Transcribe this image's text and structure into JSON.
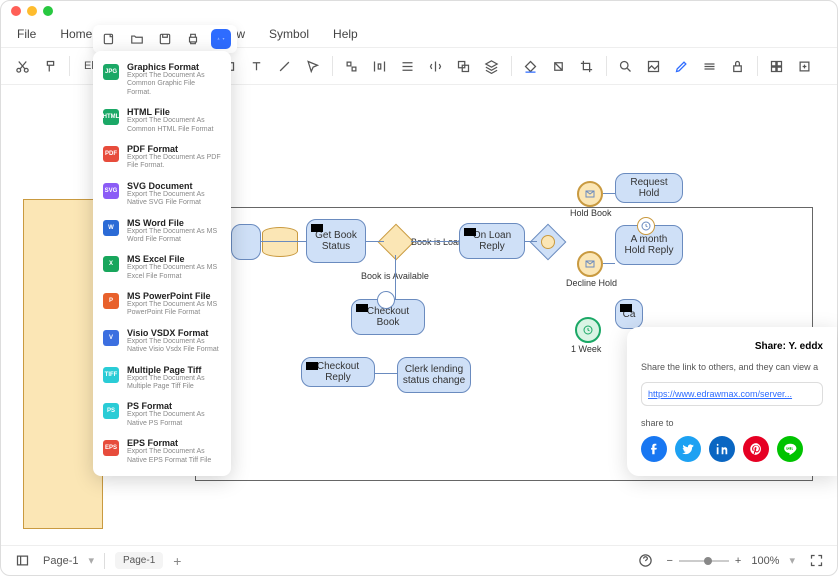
{
  "menubar": {
    "file": "File",
    "home": "Home",
    "view": "w",
    "symbol": "Symbol",
    "help": "Help"
  },
  "toolbar": {
    "element_label": "Ele"
  },
  "export_menu": {
    "items": [
      {
        "title": "Graphics Format",
        "sub": "Export The Document As Common Graphic File Format.",
        "color": "#1ba866",
        "tag": "JPG"
      },
      {
        "title": "HTML File",
        "sub": "Export The Document As Common HTML File Format",
        "color": "#1ba866",
        "tag": "HTML"
      },
      {
        "title": "PDF Format",
        "sub": "Export The Document As PDF File Format.",
        "color": "#e74c3c",
        "tag": "PDF"
      },
      {
        "title": "SVG Document",
        "sub": "Export The Document As Native SVG File Format",
        "color": "#8b5cf6",
        "tag": "SVG"
      },
      {
        "title": "MS Word File",
        "sub": "Export The Document As MS Word File Format",
        "color": "#2b6bd6",
        "tag": "W"
      },
      {
        "title": "MS Excel File",
        "sub": "Export The Document As MS Excel File Format",
        "color": "#18a65c",
        "tag": "X"
      },
      {
        "title": "MS PowerPoint File",
        "sub": "Export The Document As MS PowerPoint File Format",
        "color": "#e8612c",
        "tag": "P"
      },
      {
        "title": "Visio VSDX Format",
        "sub": "Export The Document As Native Visio Vsdx File Format",
        "color": "#3c6fe0",
        "tag": "V"
      },
      {
        "title": "Multiple Page Tiff",
        "sub": "Export The Document As Multiple Page Tiff File",
        "color": "#2accd6",
        "tag": "TIFF"
      },
      {
        "title": "PS Format",
        "sub": "Export The Document As Native PS Format",
        "color": "#2accd6",
        "tag": "PS"
      },
      {
        "title": "EPS Format",
        "sub": "Export The Document As Native EPS Format Tiff File",
        "color": "#e74c3c",
        "tag": "EPS"
      }
    ]
  },
  "diagram": {
    "nodes": {
      "get_book_status": "Get Book Status",
      "on_loan_reply": "On Loan Reply",
      "request_hold": "Request Hold",
      "month_hold_reply": "A month Hold Reply",
      "ca": "Ca",
      "checkout_book": "Checkout Book",
      "checkout_reply": "Checkout Reply",
      "clerk_lending": "Clerk lending status change"
    },
    "labels": {
      "book_is_loan": "Book is Loan",
      "book_available": "Book is Available",
      "hold_book": "Hold Book",
      "decline_hold": "Decline Hold",
      "one_week": "1 Week"
    }
  },
  "share": {
    "title": "Share: Y. eddx",
    "desc": "Share the link to others, and they can view a",
    "link": "https://www.edrawmax.com/server...",
    "share_to": "share to"
  },
  "status": {
    "page_selector": "Page-1",
    "page_tab": "Page-1",
    "zoom": "100%"
  }
}
